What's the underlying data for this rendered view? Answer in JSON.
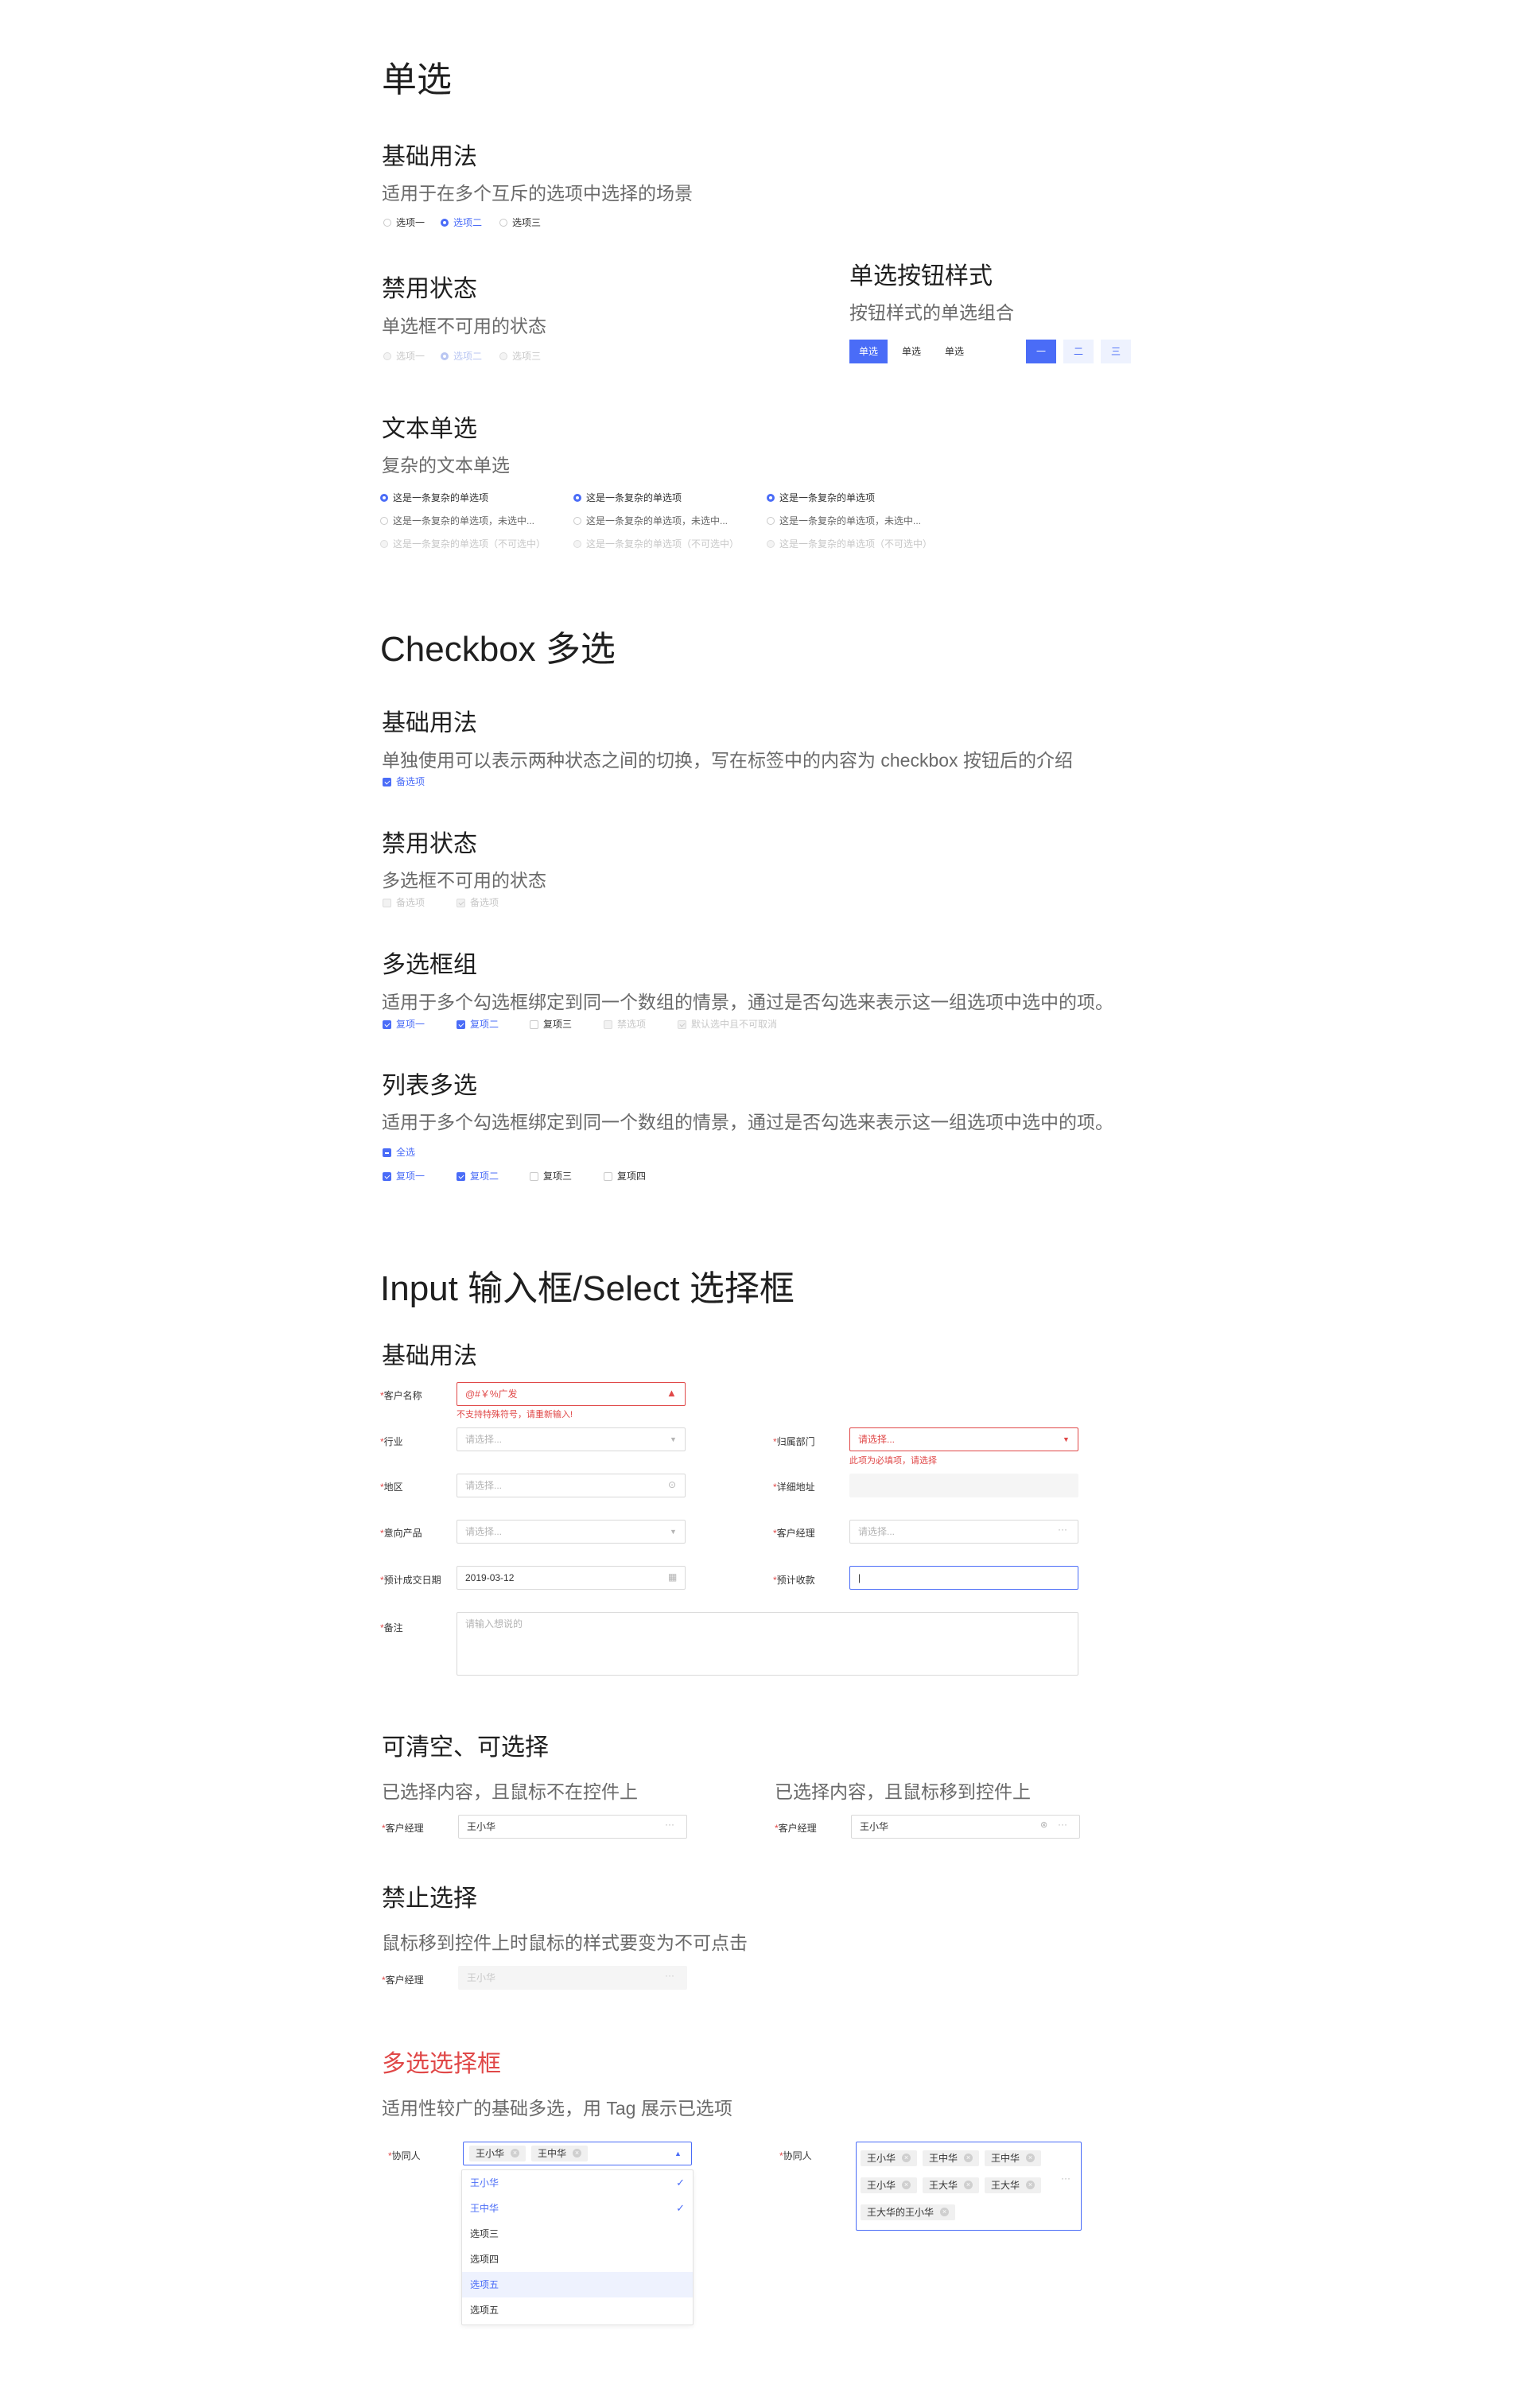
{
  "radio": {
    "title": "单选",
    "basic": {
      "title": "基础用法",
      "desc": "适用于在多个互斥的选项中选择的场景",
      "options": [
        "选项一",
        "选项二",
        "选项三"
      ]
    },
    "disabled": {
      "title": "禁用状态",
      "desc": "单选框不可用的状态",
      "options": [
        "选项一",
        "选项二",
        "选项三"
      ]
    },
    "button_style": {
      "title": "单选按钮样式",
      "desc": "按钮样式的单选组合",
      "group1": [
        "单选",
        "单选",
        "单选"
      ],
      "group2": [
        "一",
        "二",
        "三"
      ]
    },
    "text_radio": {
      "title": "文本单选",
      "desc": "复杂的文本单选",
      "item_checked": "这是一条复杂的单选项",
      "item_unchecked": "这是一条复杂的单选项，未选中...",
      "item_disabled": "这是一条复杂的单选项（不可选中）"
    }
  },
  "checkbox": {
    "title": "Checkbox 多选",
    "basic": {
      "title": "基础用法",
      "desc": "单独使用可以表示两种状态之间的切换，写在标签中的内容为 checkbox 按钮后的介绍",
      "option": "备选项"
    },
    "disabled": {
      "title": "禁用状态",
      "desc": "多选框不可用的状态",
      "options": [
        "备选项",
        "备选项"
      ]
    },
    "group": {
      "title": "多选框组",
      "desc": "适用于多个勾选框绑定到同一个数组的情景，通过是否勾选来表示这一组选项中选中的项。",
      "options": [
        "复项一",
        "复项二",
        "复项三",
        "禁选项",
        "默认选中且不可取消"
      ]
    },
    "list": {
      "title": "列表多选",
      "desc": "适用于多个勾选框绑定到同一个数组的情景，通过是否勾选来表示这一组选项中选中的项。",
      "all": "全选",
      "options": [
        "复项一",
        "复项二",
        "复项三",
        "复项四"
      ]
    }
  },
  "input": {
    "title": "Input 输入框/Select 选择框",
    "basic": {
      "title": "基础用法",
      "customer_name": {
        "label": "客户名称",
        "value": "@#￥%广发",
        "error": "不支持特殊符号，请重新输入!"
      },
      "industry": {
        "label": "行业",
        "placeholder": "请选择..."
      },
      "department": {
        "label": "归属部门",
        "placeholder": "请选择...",
        "error": "此项为必填项，请选择"
      },
      "region": {
        "label": "地区",
        "placeholder": "请选择..."
      },
      "address": {
        "label": "详细地址"
      },
      "product": {
        "label": "意向产品",
        "placeholder": "请选择..."
      },
      "manager": {
        "label": "客户经理",
        "placeholder": "请选择..."
      },
      "deal_date": {
        "label": "预计成交日期",
        "value": "2019-03-12"
      },
      "expected_revenue": {
        "label": "预计收款",
        "value": "|"
      },
      "remark": {
        "label": "备注",
        "placeholder": "请输入想说的"
      }
    },
    "clearable": {
      "title": "可清空、可选择",
      "left_desc": "已选择内容，且鼠标不在控件上",
      "right_desc": "已选择内容，且鼠标移到控件上",
      "label": "客户经理",
      "value": "王小华"
    },
    "disabled": {
      "title": "禁止选择",
      "desc": "鼠标移到控件上时鼠标的样式要变为不可点击",
      "label": "客户经理",
      "value": "王小华"
    },
    "multi": {
      "title": "多选选择框",
      "desc": "适用性较广的基础多选，用 Tag 展示已选项",
      "label": "协同人",
      "selected": [
        "王小华",
        "王中华"
      ],
      "options": [
        "王小华",
        "王中华",
        "选项三",
        "选项四",
        "选项五",
        "选项五"
      ],
      "right_tags": [
        "王小华",
        "王中华",
        "王中华",
        "王小华",
        "王大华",
        "王大华",
        "王大华的王小华"
      ]
    }
  },
  "colors": {
    "primary": "#4a6cf7",
    "error": "#e04848",
    "disabled": "#c8c8c8"
  }
}
